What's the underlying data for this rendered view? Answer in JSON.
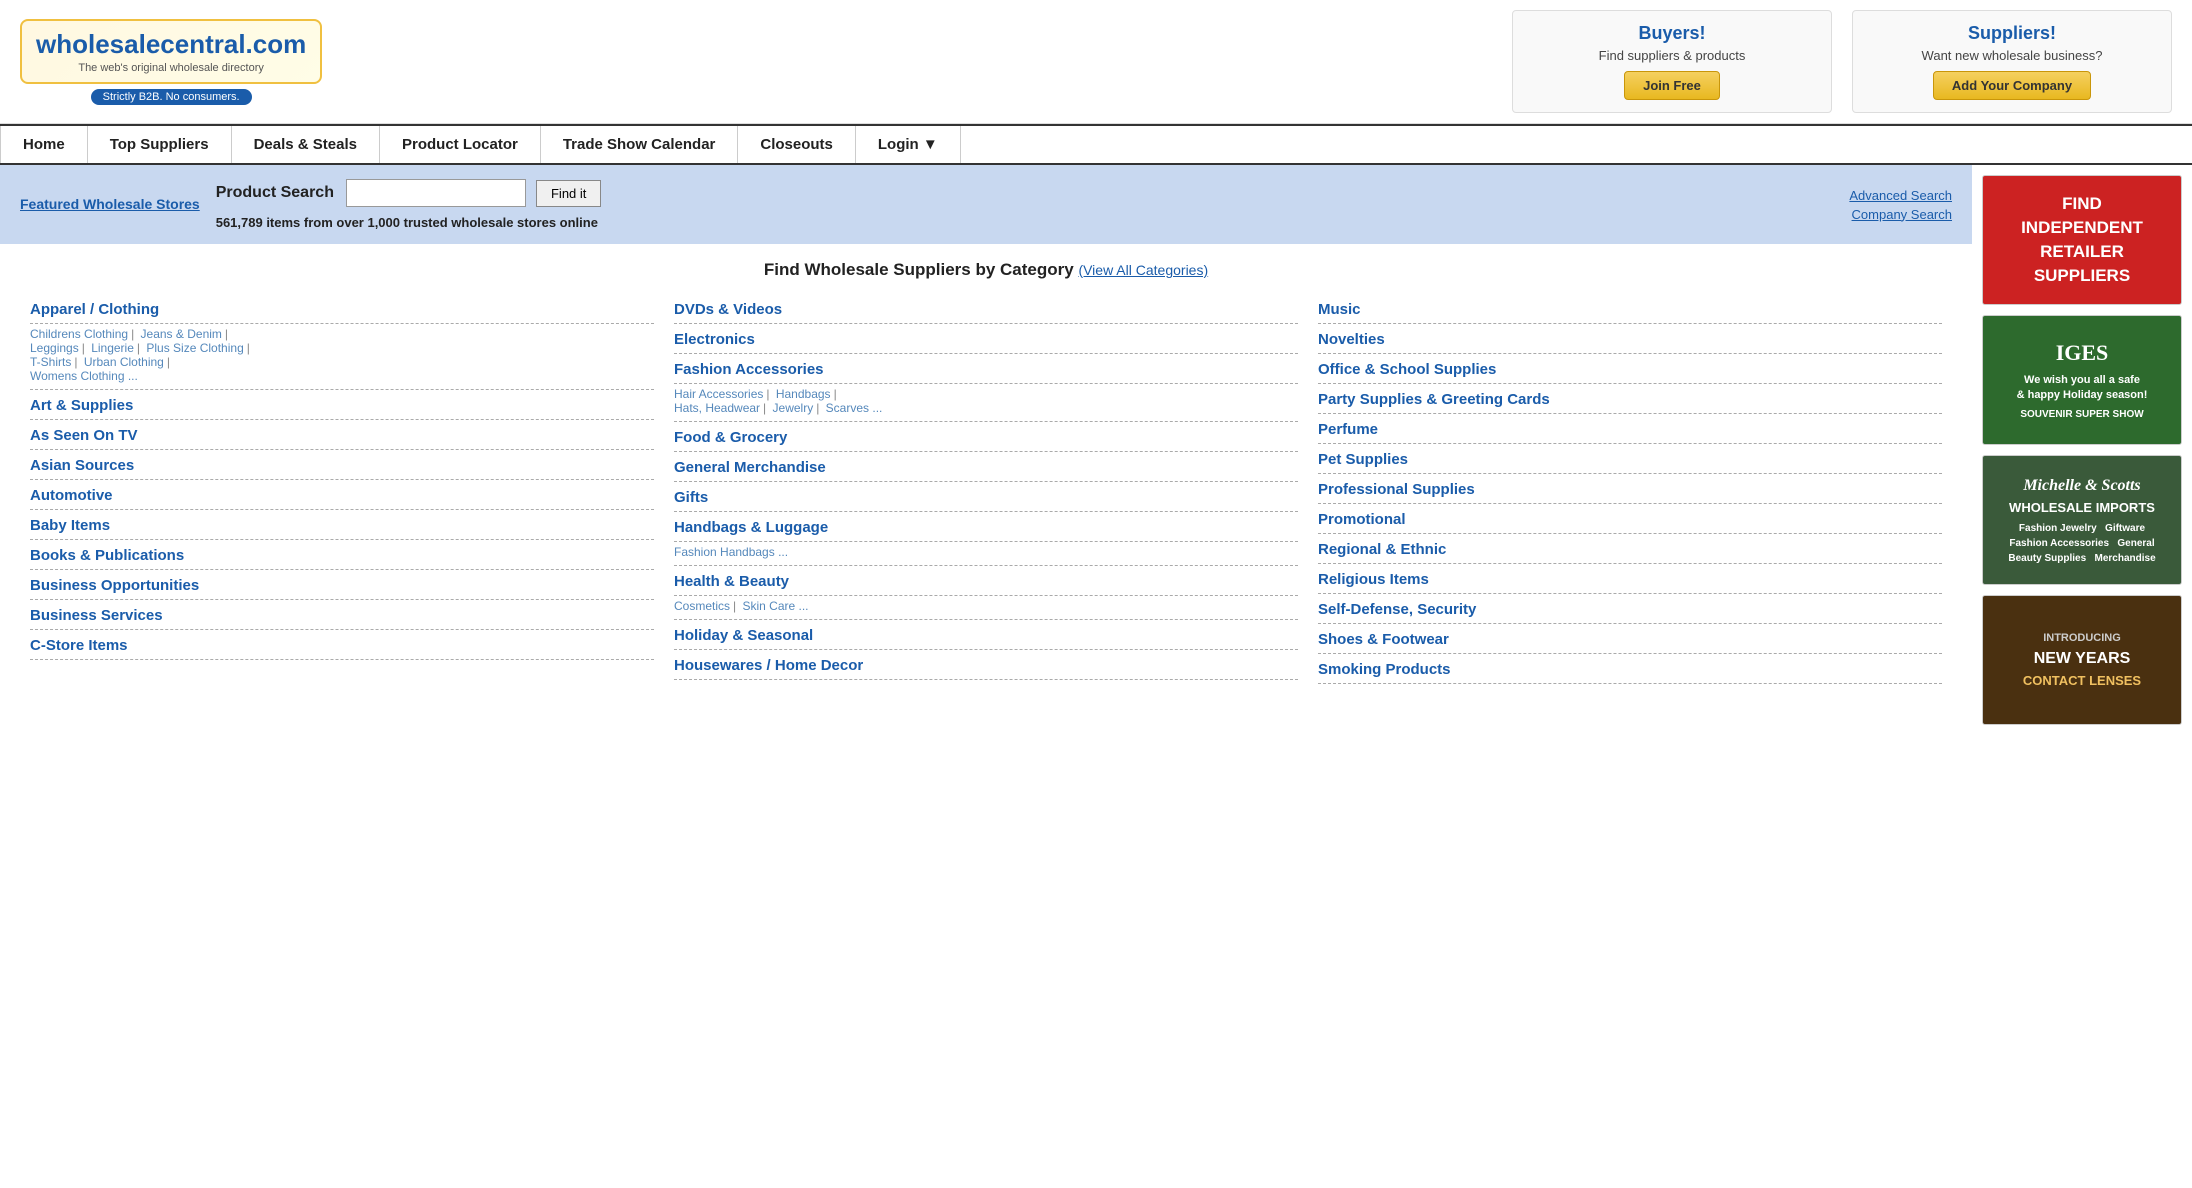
{
  "header": {
    "logo": {
      "brand": "wholesalecentral",
      "tld": ".com",
      "tagline": "The web's original wholesale directory",
      "badge": "Strictly B2B. No consumers."
    },
    "buyers_box": {
      "title": "Buyers!",
      "subtitle": "Find suppliers & products",
      "btn_label": "Join Free"
    },
    "suppliers_box": {
      "title": "Suppliers!",
      "subtitle": "Want new wholesale business?",
      "btn_label": "Add Your Company"
    }
  },
  "nav": {
    "items": [
      {
        "label": "Home",
        "id": "home"
      },
      {
        "label": "Top Suppliers",
        "id": "top-suppliers"
      },
      {
        "label": "Deals & Steals",
        "id": "deals-steals"
      },
      {
        "label": "Product Locator",
        "id": "product-locator"
      },
      {
        "label": "Trade Show Calendar",
        "id": "trade-show"
      },
      {
        "label": "Closeouts",
        "id": "closeouts"
      },
      {
        "label": "Login ▼",
        "id": "login"
      }
    ]
  },
  "search_bar": {
    "featured_label": "Featured Wholesale Stores",
    "search_label": "Product Search",
    "find_btn": "Find it",
    "count_text": "561,789 items from over 1,000 trusted wholesale stores online",
    "advanced_search": "Advanced Search",
    "company_search": "Company Search",
    "placeholder": ""
  },
  "categories": {
    "title": "Find Wholesale Suppliers by Category",
    "view_all": "(View All Categories)",
    "col1": [
      {
        "label": "Apparel / Clothing",
        "subs": [
          {
            "text": "Childrens Clothing"
          },
          {
            "sep": true
          },
          {
            "text": "Jeans & Denim"
          },
          {
            "sep": true
          },
          {
            "text": "Leggings"
          },
          {
            "sep": true
          },
          {
            "text": "Lingerie"
          },
          {
            "sep": true
          },
          {
            "text": "Plus Size Clothing"
          },
          {
            "sep": true
          },
          {
            "text": "T-Shirts"
          },
          {
            "sep": true
          },
          {
            "text": "Urban Clothing"
          },
          {
            "sep": true
          },
          {
            "text": "Womens Clothing ..."
          }
        ]
      },
      {
        "label": "Art & Supplies",
        "subs": []
      },
      {
        "label": "As Seen On TV",
        "subs": []
      },
      {
        "label": "Asian Sources",
        "subs": []
      },
      {
        "label": "Automotive",
        "subs": []
      },
      {
        "label": "Baby Items",
        "subs": []
      },
      {
        "label": "Books & Publications",
        "subs": []
      },
      {
        "label": "Business Opportunities",
        "subs": []
      },
      {
        "label": "Business Services",
        "subs": []
      },
      {
        "label": "C-Store Items",
        "subs": []
      }
    ],
    "col2": [
      {
        "label": "DVDs & Videos",
        "subs": []
      },
      {
        "label": "Electronics",
        "subs": []
      },
      {
        "label": "Fashion Accessories",
        "subs": [
          {
            "text": "Hair Accessories"
          },
          {
            "sep": true
          },
          {
            "text": "Handbags"
          },
          {
            "sep": true
          },
          {
            "text": "Hats, Headwear"
          },
          {
            "sep": true
          },
          {
            "text": "Jewelry"
          },
          {
            "sep": true
          },
          {
            "text": "Scarves ..."
          }
        ]
      },
      {
        "label": "Food & Grocery",
        "subs": []
      },
      {
        "label": "General Merchandise",
        "subs": []
      },
      {
        "label": "Gifts",
        "subs": []
      },
      {
        "label": "Handbags & Luggage",
        "subs": [
          {
            "text": "Fashion Handbags ..."
          }
        ]
      },
      {
        "label": "Health & Beauty",
        "subs": [
          {
            "text": "Cosmetics"
          },
          {
            "sep": true
          },
          {
            "text": "Skin Care ..."
          }
        ]
      },
      {
        "label": "Holiday & Seasonal",
        "subs": []
      },
      {
        "label": "Housewares / Home Decor",
        "subs": []
      }
    ],
    "col3": [
      {
        "label": "Music",
        "subs": []
      },
      {
        "label": "Novelties",
        "subs": []
      },
      {
        "label": "Office & School Supplies",
        "subs": []
      },
      {
        "label": "Party Supplies & Greeting Cards",
        "subs": []
      },
      {
        "label": "Perfume",
        "subs": []
      },
      {
        "label": "Pet Supplies",
        "subs": []
      },
      {
        "label": "Professional Supplies",
        "subs": []
      },
      {
        "label": "Promotional",
        "subs": []
      },
      {
        "label": "Regional & Ethnic",
        "subs": []
      },
      {
        "label": "Religious Items",
        "subs": []
      },
      {
        "label": "Self-Defense, Security",
        "subs": []
      },
      {
        "label": "Shoes & Footwear",
        "subs": []
      },
      {
        "label": "Smoking Products",
        "subs": []
      }
    ]
  },
  "ads": [
    {
      "id": "ad1",
      "type": "red",
      "text": "FIND\nINDEPENDENT\nRETAILER\nSUPPLIERS"
    },
    {
      "id": "ad2",
      "type": "green",
      "text": "IGES\nWe wish you all a safe & happy Holiday season!\nSOUVENIR SUPER SHOW"
    },
    {
      "id": "ad3",
      "type": "purple",
      "text": "Michelle & Scotts\nWHOLESALE IMPORTS\nFashion Jewelry | Giftware\nFashion Accessories | General\nBeauty Supplies | Merchandise"
    },
    {
      "id": "ad4",
      "type": "brown",
      "text": "INTRODUCING\nNEW YEARS\nCONTACT LENSES"
    }
  ]
}
